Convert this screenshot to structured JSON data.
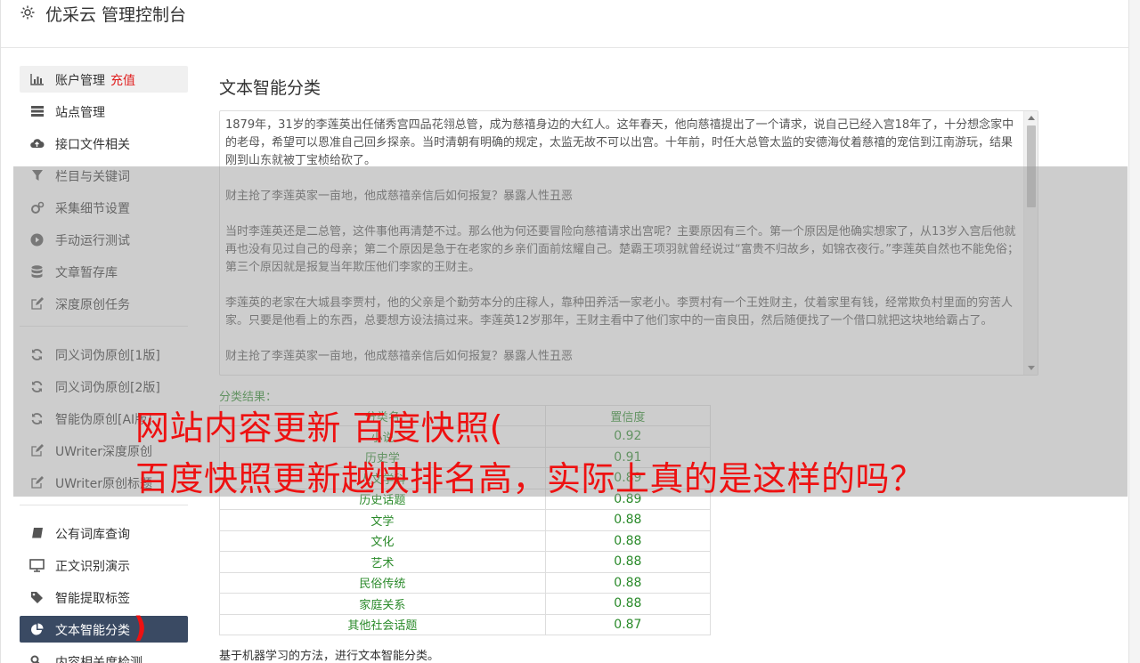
{
  "app": {
    "title": "优采云 管理控制台",
    "gear_icon": "gear-icon"
  },
  "sidebar": {
    "items": [
      {
        "label": "账户管理",
        "badge": "充值",
        "icon": "bar-chart-icon"
      },
      {
        "label": "站点管理",
        "icon": "server-icon"
      },
      {
        "label": "接口文件相关",
        "icon": "cloud-upload-icon"
      },
      {
        "label": "栏目与关键词",
        "icon": "filter-icon"
      },
      {
        "label": "采集细节设置",
        "icon": "cogs-icon"
      },
      {
        "label": "手动运行测试",
        "icon": "play-circle-icon"
      },
      {
        "label": "文章暂存库",
        "icon": "database-icon"
      },
      {
        "label": "深度原创任务",
        "icon": "edit-icon"
      },
      {
        "label": "同义词伪原创[1版]",
        "icon": "refresh-icon"
      },
      {
        "label": "同义词伪原创[2版]",
        "icon": "refresh-icon"
      },
      {
        "label": "智能伪原创[AI版]",
        "icon": "refresh-icon"
      },
      {
        "label": "UWriter深度原创",
        "icon": "edit-icon"
      },
      {
        "label": "UWriter原创标题",
        "icon": "edit-icon"
      },
      {
        "label": "公有词库查询",
        "icon": "book-icon"
      },
      {
        "label": "正文识别演示",
        "icon": "monitor-icon"
      },
      {
        "label": "智能提取标签",
        "icon": "tag-icon"
      },
      {
        "label": "文本智能分类",
        "icon": "pie-chart-icon"
      },
      {
        "label": "内容相关度检测",
        "icon": "key-icon"
      }
    ]
  },
  "main": {
    "title": "文本智能分类",
    "paragraphs": [
      "1879年，31岁的李莲英出任储秀宫四品花翎总管，成为慈禧身边的大红人。这年春天，他向慈禧提出了一个请求，说自己已经入宫18年了，十分想念家中的老母，希望可以恩准自己回乡探亲。当时清朝有明确的规定，太监无故不可以出宫。十年前，时任大总管太监的安德海仗着慈禧的宠信到江南游玩，结果刚到山东就被丁宝桢给砍了。",
      "财主抢了李莲英家一亩地，他成慈禧亲信后如何报复？暴露人性丑恶",
      "当时李莲英还是二总管，这件事他再清楚不过。那么他为何还要冒险向慈禧请求出宫呢？主要原因有三个。第一个原因是他确实想家了，从13岁入宫后他就再也没有见过自己的母亲；第二个原因是急于在老家的乡亲们面前炫耀自己。楚霸王项羽就曾经说过“富贵不归故乡，如锦衣夜行。”李莲英自然也不能免俗；第三个原因就是报复当年欺压他们李家的王财主。",
      "李莲英的老家在大城县李贾村，他的父亲是个勤劳本分的庄稼人，靠种田养活一家老小。李贾村有一个王姓财主，仗着家里有钱，经常欺负村里面的穷苦人家。只要是他看上的东西，总要想方设法搞过来。李莲英12岁那年，王财主看中了他们家中的一亩良田，然后随便找了一个借口就把这块地给霸占了。",
      "财主抢了李莲英家一亩地，他成慈禧亲信后如何报复？暴露人性丑恶"
    ],
    "result_label": "分类结果：",
    "table": {
      "headers": [
        "分类名",
        "置信度"
      ],
      "rows": [
        [
          "小说",
          "0.92"
        ],
        [
          "历史学",
          "0.91"
        ],
        [
          "人文学科",
          "0.89"
        ],
        [
          "历史话题",
          "0.89"
        ],
        [
          "文学",
          "0.88"
        ],
        [
          "文化",
          "0.88"
        ],
        [
          "艺术",
          "0.88"
        ],
        [
          "民俗传统",
          "0.88"
        ],
        [
          "家庭关系",
          "0.88"
        ],
        [
          "其他社会话题",
          "0.87"
        ]
      ]
    },
    "footer": "基于机器学习的方法，进行文本智能分类。"
  },
  "overlay": {
    "line1": "网站内容更新 百度快照(",
    "line2": "百度快照更新越快排名高，实际上真的是这样的吗？",
    "paren": ")"
  },
  "colors": {
    "active_bg": "#3a4a63",
    "accent_red": "#ee1111",
    "result_green": "#2a8a2a"
  }
}
